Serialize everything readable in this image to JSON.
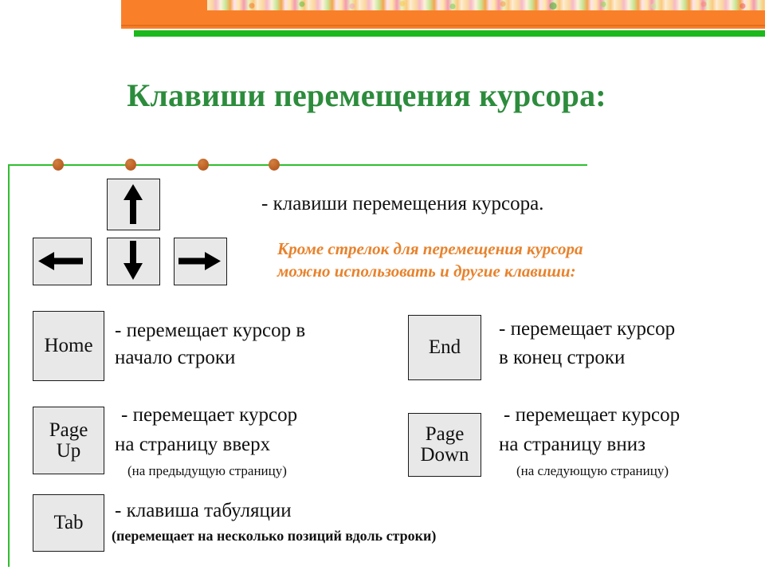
{
  "slide": {
    "title": "Клавиши перемещения курсора:",
    "colors": {
      "banner_orange": "#F98028",
      "banner_green": "#1DB81D",
      "title_green": "#2C8C3C",
      "frame_green": "#2FBF2F",
      "dot_brown": "#C3682B",
      "accent_orange_text": "#E8822C",
      "key_fill": "#E8E8E8",
      "key_border": "#1A1A1A",
      "body_text": "#111111"
    },
    "decor": {
      "dot_count": 4,
      "photo_strip_label": "colorful-photo-strip"
    }
  },
  "arrow_keys": {
    "up": {
      "icon": "arrow-up-icon",
      "name": "Up"
    },
    "down": {
      "icon": "arrow-down-icon",
      "name": "Down"
    },
    "left": {
      "icon": "arrow-left-icon",
      "name": "Left"
    },
    "right": {
      "icon": "arrow-right-icon",
      "name": "Right"
    },
    "caption": "- клавиши перемещения курсора."
  },
  "orange_note": {
    "line1": "Кроме стрелок для перемещения курсора",
    "line2": "можно использовать и другие клавиши:"
  },
  "keys": [
    {
      "id": "home",
      "label": "Home",
      "label_lines": [
        "Home"
      ],
      "desc_line1": "- перемещает курсор в",
      "desc_line2": "начало строки",
      "sub": ""
    },
    {
      "id": "end",
      "label": "End",
      "label_lines": [
        "End"
      ],
      "desc_line1": "- перемещает курсор",
      "desc_line2": "в конец строки",
      "sub": ""
    },
    {
      "id": "page-up",
      "label": "Page Up",
      "label_lines": [
        "Page",
        "Up"
      ],
      "desc_line1": "- перемещает курсор",
      "desc_line2": "на страницу вверх",
      "sub": "(на предыдущую страницу)"
    },
    {
      "id": "page-down",
      "label": "Page Down",
      "label_lines": [
        "Page",
        "Down"
      ],
      "desc_line1": "- перемещает курсор",
      "desc_line2": "на страницу вниз",
      "sub": "(на следующую страницу)"
    },
    {
      "id": "tab",
      "label": "Tab",
      "label_lines": [
        "Tab"
      ],
      "desc_line1": "- клавиша табуляции",
      "desc_line2": "",
      "sub": "(перемещает на несколько позиций вдоль строки)"
    }
  ]
}
